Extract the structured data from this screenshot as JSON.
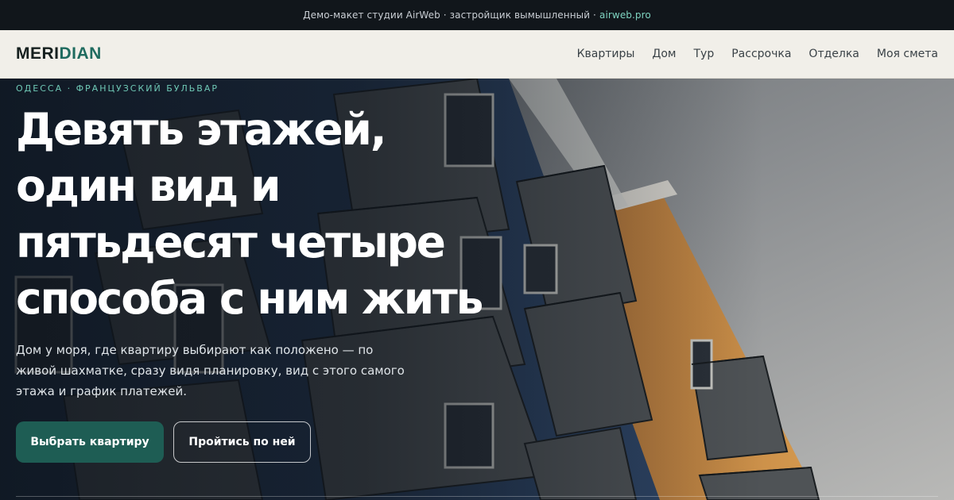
{
  "topbar": {
    "text": "Демо-макет студии AirWeb · застройщик вымышленный ·",
    "link": "airweb.pro"
  },
  "header": {
    "logo_part1": "MERI",
    "logo_part2": "DIAN",
    "nav": [
      {
        "label": "Квартиры"
      },
      {
        "label": "Дом"
      },
      {
        "label": "Тур"
      },
      {
        "label": "Рассрочка"
      },
      {
        "label": "Отделка"
      },
      {
        "label": "Моя смета"
      }
    ]
  },
  "hero": {
    "kicker": "ОДЕССА · ФРАНЦУЗСКИЙ БУЛЬВАР",
    "headline_lines": [
      "Девять этажей,",
      "один вид и",
      "пятьдесят четыре",
      "способа с ним жить"
    ],
    "lede": "Дом у моря, где квартиру выбирают как положено — по живой шахматке, сразу видя планировку, вид с этого самого этажа и график платежей.",
    "primary_button": "Выбрать квартиру",
    "secondary_button": "Пройтись по ней"
  },
  "colors": {
    "accent": "#1e5d54",
    "kicker": "#6fc9b6",
    "topbar_bg": "#11161b",
    "header_bg": "#f1efe9"
  }
}
